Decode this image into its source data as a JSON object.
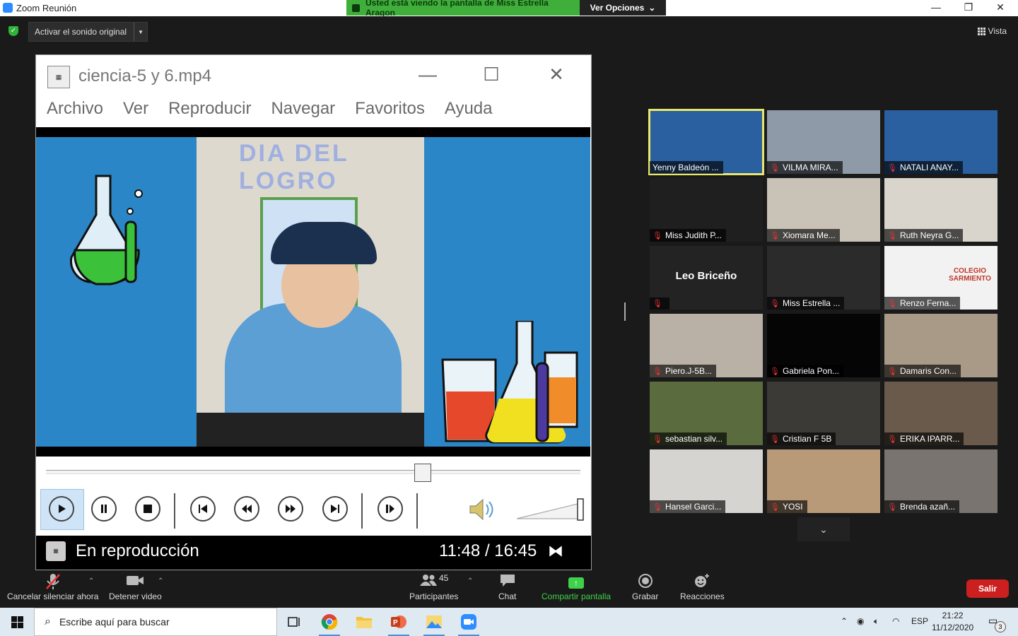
{
  "zoom_window": {
    "title": "Zoom Reunión"
  },
  "share_banner": {
    "text": "Usted está viendo la pantalla de Miss Estrella Aragon",
    "options_label": "Ver Opciones"
  },
  "original_sound": {
    "label": "Activar el sonido original"
  },
  "view_button": {
    "label": "Vista"
  },
  "media_player": {
    "title": "ciencia-5 y 6.mp4",
    "menu": [
      "Archivo",
      "Ver",
      "Reproducir",
      "Navegar",
      "Favoritos",
      "Ayuda"
    ],
    "video_banner": "DIA DEL LOGRO",
    "seek_progress": 0.71,
    "status": "En reproducción",
    "time": "11:48 / 16:45"
  },
  "participants": [
    {
      "name": "Yenny Baldeón ...",
      "muted": false,
      "active_speaker": true,
      "bg": "#2a5fa0"
    },
    {
      "name": "VILMA MIRA...",
      "muted": true,
      "bg": "#8f9aa8"
    },
    {
      "name": "NATALI ANAY...",
      "muted": true,
      "bg": "#2a5fa0"
    },
    {
      "name": "Miss Judith P...",
      "muted": true,
      "bg": "#1f1f1f"
    },
    {
      "name": "Xiomara Me...",
      "muted": true,
      "bg": "#c9c2b7"
    },
    {
      "name": "Ruth Neyra G...",
      "muted": true,
      "bg": "#d9d5cd"
    },
    {
      "name": "",
      "display_name": "Leo Briceño",
      "muted": true,
      "bg": "#232323"
    },
    {
      "name": "Miss Estrella ...",
      "muted": true,
      "bg": "#2b2b2b"
    },
    {
      "name": "Renzo Ferna...",
      "muted": true,
      "bg": "#f2f2f2",
      "overlay_text": "COLEGIO SARMIENTO"
    },
    {
      "name": "Piero.J-5B...",
      "muted": true,
      "bg": "#b9b1a6"
    },
    {
      "name": "Gabriela Pon...",
      "muted": true,
      "bg": "#050505"
    },
    {
      "name": "Damaris Con...",
      "muted": true,
      "bg": "#a89a86"
    },
    {
      "name": "sebastian silv...",
      "muted": true,
      "bg": "#5a6b3e"
    },
    {
      "name": "Cristian F 5B",
      "muted": true,
      "bg": "#3c3a36"
    },
    {
      "name": "ERIKA IPARR...",
      "muted": true,
      "bg": "#6a5a4c"
    },
    {
      "name": "Hansel Garci...",
      "muted": true,
      "bg": "#d6d4d0"
    },
    {
      "name": "YOSI",
      "muted": true,
      "bg": "#b89a78"
    },
    {
      "name": "Brenda azañ...",
      "muted": true,
      "bg": "#7a7470"
    }
  ],
  "toolbar": {
    "mute_label": "Cancelar silenciar ahora",
    "video_label": "Detener video",
    "participants_label": "Participantes",
    "participants_count": "45",
    "chat_label": "Chat",
    "share_label": "Compartir pantalla",
    "record_label": "Grabar",
    "reactions_label": "Reacciones",
    "leave_label": "Salir"
  },
  "taskbar": {
    "search_placeholder": "Escribe aquí para buscar",
    "language": "ESP",
    "time": "21:22",
    "date": "11/12/2020",
    "notifications": "3"
  },
  "colors": {
    "zoom_blue": "#2d8cff",
    "share_green": "#3fae3b",
    "leave_red": "#cc1f1f",
    "mute_red": "#e33333",
    "highlight": "#e9e66c"
  }
}
